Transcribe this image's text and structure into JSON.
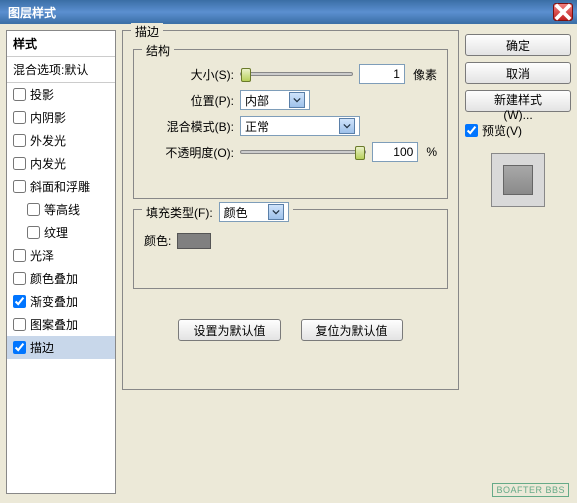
{
  "window": {
    "title": "图层样式"
  },
  "sidebar": {
    "header": "样式",
    "blend": "混合选项:默认",
    "items": [
      {
        "label": "投影",
        "checked": false
      },
      {
        "label": "内阴影",
        "checked": false
      },
      {
        "label": "外发光",
        "checked": false
      },
      {
        "label": "内发光",
        "checked": false
      },
      {
        "label": "斜面和浮雕",
        "checked": false
      },
      {
        "label": "等高线",
        "checked": false,
        "indent": true
      },
      {
        "label": "纹理",
        "checked": false,
        "indent": true
      },
      {
        "label": "光泽",
        "checked": false
      },
      {
        "label": "颜色叠加",
        "checked": false
      },
      {
        "label": "渐变叠加",
        "checked": true
      },
      {
        "label": "图案叠加",
        "checked": false
      },
      {
        "label": "描边",
        "checked": true,
        "selected": true
      }
    ]
  },
  "stroke": {
    "group_label": "描边",
    "structure_label": "结构",
    "size_label": "大小(S):",
    "size_value": "1",
    "size_unit": "像素",
    "position_label": "位置(P):",
    "position_value": "内部",
    "blendmode_label": "混合模式(B):",
    "blendmode_value": "正常",
    "opacity_label": "不透明度(O):",
    "opacity_value": "100",
    "opacity_unit": "%",
    "filltype_group": "填充类型(F):",
    "filltype_value": "颜色",
    "color_label": "颜色:",
    "color_value": "#808080",
    "set_default": "设置为默认值",
    "reset_default": "复位为默认值"
  },
  "right": {
    "ok": "确定",
    "cancel": "取消",
    "new_style": "新建样式(W)...",
    "preview_label": "预览(V)",
    "preview_checked": true
  },
  "watermark": "BOAFTER BBS"
}
